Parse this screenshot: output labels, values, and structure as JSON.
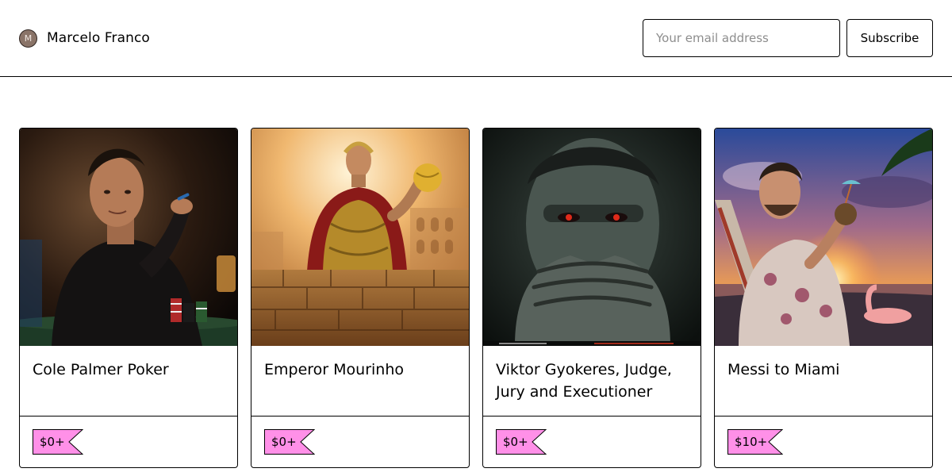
{
  "header": {
    "avatar_initial": "M",
    "creator_name": "Marcelo Franco",
    "email_placeholder": "Your email address",
    "subscribe_label": "Subscribe"
  },
  "theme": {
    "price_tag_color": "#ff90e8",
    "border_color": "#000000"
  },
  "products": [
    {
      "title": "Cole Palmer Poker",
      "price": "$0+",
      "image_icon": "poker-player-image"
    },
    {
      "title": "Emperor Mourinho",
      "price": "$0+",
      "image_icon": "roman-emperor-image"
    },
    {
      "title": "Viktor Gyokeres, Judge, Jury and Executioner",
      "price": "$0+",
      "image_icon": "masked-face-image"
    },
    {
      "title": "Messi to Miami",
      "price": "$10+",
      "image_icon": "beach-sunset-image"
    }
  ]
}
